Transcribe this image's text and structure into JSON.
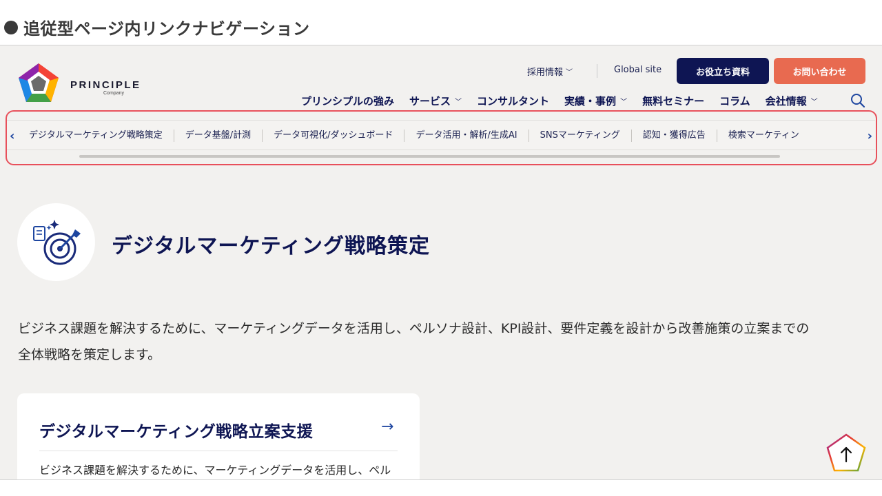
{
  "slide": {
    "title": "追従型ページ内リンクナビゲーション"
  },
  "header": {
    "logo_text": "PRINCIPLE",
    "logo_sub": "Company",
    "util_links": [
      {
        "label": "採用情報",
        "has_dropdown": true
      },
      {
        "label": "Global site",
        "has_dropdown": false
      }
    ],
    "cta_doc": "お役立ち資料",
    "cta_contact": "お問い合わせ",
    "nav": [
      {
        "label": "プリンシプルの強み",
        "has_dropdown": false
      },
      {
        "label": "サービス",
        "has_dropdown": true
      },
      {
        "label": "コンサルタント",
        "has_dropdown": false
      },
      {
        "label": "実績・事例",
        "has_dropdown": true
      },
      {
        "label": "無料セミナー",
        "has_dropdown": false
      },
      {
        "label": "コラム",
        "has_dropdown": false
      },
      {
        "label": "会社情報",
        "has_dropdown": true
      }
    ],
    "search_icon": "search-icon"
  },
  "anchor_nav": {
    "items": [
      "デジタルマーケティング戦略策定",
      "データ基盤/計測",
      "データ可視化/ダッシュボード",
      "データ活用・解析/生成AI",
      "SNSマーケティング",
      "認知・獲得広告",
      "検索マーケティン"
    ],
    "prev_glyph": "‹",
    "next_glyph": "›"
  },
  "section": {
    "title": "デジタルマーケティング戦略策定",
    "icon": "target-strategy-icon",
    "lead_line1": "ビジネス課題を解決するために、マーケティングデータを活用し、ペルソナ設計、KPI設計、要件定義を設計から改善施策の立案までの",
    "lead_line2": "全体戦略を策定します。"
  },
  "card": {
    "title": "デジタルマーケティング戦略立案支援",
    "arrow": "→",
    "text": "ビジネス課題を解決するために、マーケティングデータを活用し、ペル"
  },
  "colors": {
    "navy": "#0e1553",
    "accent_blue": "#1e46a0",
    "contact_orange": "#e86a50",
    "highlight_red": "#e8505b",
    "page_bg": "#f2f1ef"
  }
}
